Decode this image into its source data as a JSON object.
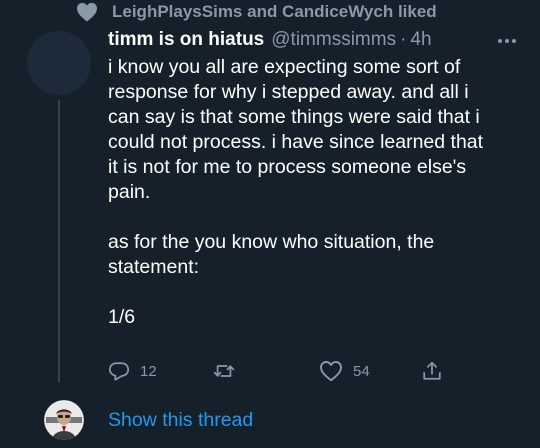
{
  "social_context": {
    "icon": "heart-icon",
    "text": "LeighPlaysSims and CandiceWych liked"
  },
  "tweet": {
    "author_name": "timm is on hiatus",
    "handle": "@timmssimms",
    "separator": "·",
    "time": "4h",
    "more_icon": "ellipsis-icon",
    "body": {
      "para1": "i know you all are expecting some sort of\nresponse for why i stepped away. and all i\ncan say is that some things were said that i\ncould not process. i have since learned that\nit is not for me to process someone else's\npain.",
      "para2": "as for the you know who situation, the\nstatement:",
      "para3": "1/6"
    },
    "actions": {
      "reply": {
        "icon": "reply-icon",
        "count": "12"
      },
      "retweet": {
        "icon": "retweet-icon",
        "count": ""
      },
      "like": {
        "icon": "heart-outline-icon",
        "count": "54"
      },
      "share": {
        "icon": "share-icon"
      }
    }
  },
  "show_thread": {
    "label": "Show this thread"
  },
  "colors": {
    "background": "#15202b",
    "secondary_text": "#8b98a5",
    "link": "#1d9bf0",
    "thread_line": "#38444d"
  }
}
